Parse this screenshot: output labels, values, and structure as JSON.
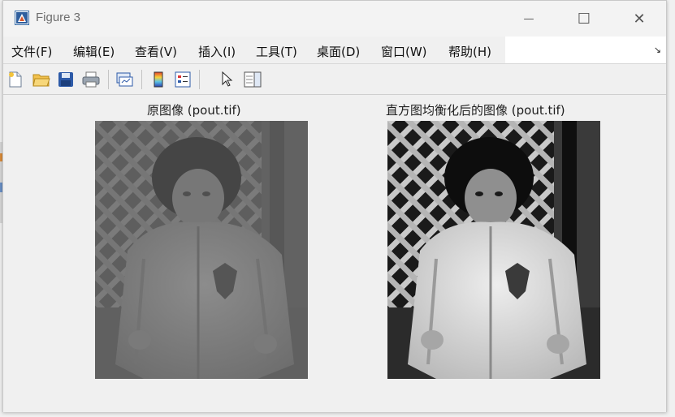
{
  "window": {
    "title": "Figure 3",
    "buttons": {
      "minimize": "—",
      "maximize": "☐",
      "close": "✕"
    }
  },
  "menu": {
    "items": [
      "文件(F)",
      "编辑(E)",
      "查看(V)",
      "插入(I)",
      "工具(T)",
      "桌面(D)",
      "窗口(W)",
      "帮助(H)"
    ],
    "overflow_icon": "dock-arrow-icon"
  },
  "toolbar": {
    "icons": [
      "new-figure-icon",
      "open-file-icon",
      "save-icon",
      "print-icon",
      "link-plot-icon",
      "colorbar-icon",
      "legend-icon",
      "pointer-icon",
      "property-inspector-icon"
    ]
  },
  "figure": {
    "left_title": "原图像 (pout.tif)",
    "right_title": "直方图均衡化后的图像 (pout.tif)"
  },
  "colors": {
    "original_tone_dark": "#4c4c4c",
    "original_tone_light": "#8a8a8a",
    "equalized_tone_dark": "#121212",
    "equalized_tone_light": "#e8e8e8"
  }
}
